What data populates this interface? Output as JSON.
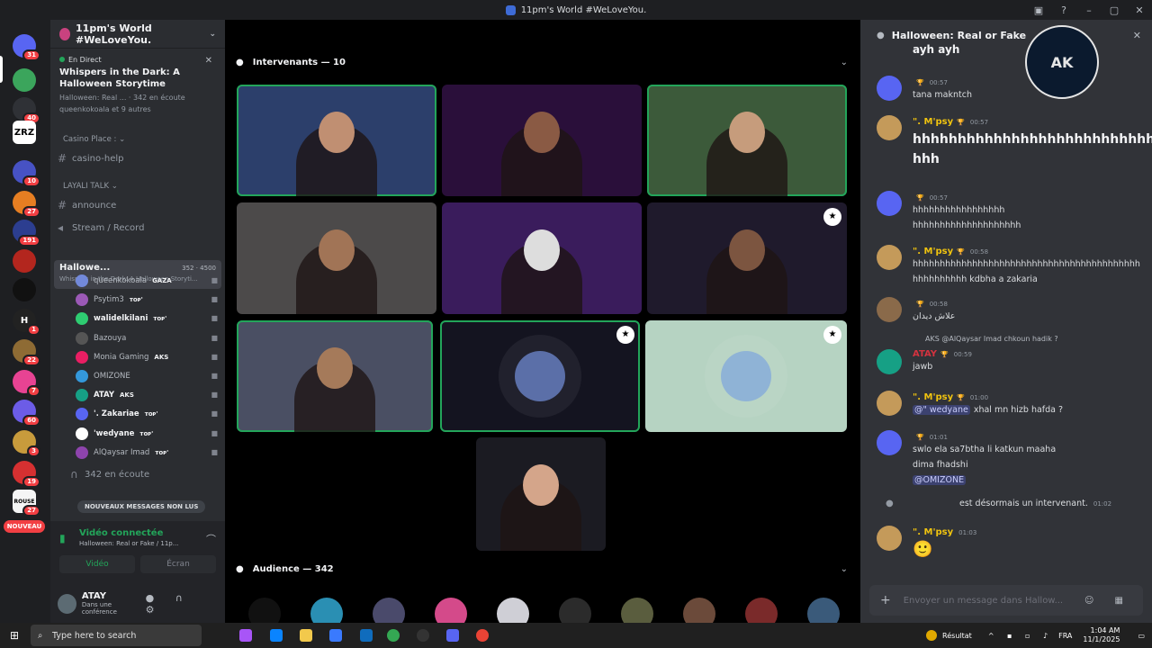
{
  "window": {
    "title": "11pm's World #WeLoveYou."
  },
  "servers": [
    {
      "label": "",
      "badge": "31",
      "color": "#5865f2"
    },
    {
      "label": "",
      "badge": "",
      "color": "#3ba55c"
    },
    {
      "label": "",
      "badge": "40",
      "color": "#2f3136"
    },
    {
      "label": "ZRZ",
      "badge": "",
      "color": "#ffffff"
    },
    {
      "label": "",
      "badge": "10",
      "color": "#4752c4"
    },
    {
      "label": "",
      "badge": "27",
      "color": "#e67e22"
    },
    {
      "label": "",
      "badge": "191",
      "color": "#2c3e90"
    },
    {
      "label": "",
      "badge": "",
      "color": "#b3261e"
    },
    {
      "label": "",
      "badge": "",
      "color": "#111111"
    },
    {
      "label": "H",
      "badge": "1",
      "color": "#222222"
    },
    {
      "label": "",
      "badge": "22",
      "color": "#8e6b34"
    },
    {
      "label": "",
      "badge": "7",
      "color": "#e84393"
    },
    {
      "label": "",
      "badge": "60",
      "color": "#6c5ce7"
    },
    {
      "label": "",
      "badge": "3",
      "color": "#c89b3c"
    },
    {
      "label": "",
      "badge": "19",
      "color": "#d63031"
    },
    {
      "label": "ROUSE",
      "badge": "27",
      "color": "#f5f5f5"
    }
  ],
  "nouveau": "NOUVEAU",
  "sidebar": {
    "server_name": "11pm's World #WeLoveYou.",
    "live": {
      "tag": "En Direct",
      "title": "Whispers in the Dark: A Halloween Storytime",
      "meta": "Halloween: Real ... · 342 en écoute",
      "meta2": "queenkokoala et 9 autres"
    },
    "cat_casino": "Casino Place :",
    "ch_casino_help": "casino-help",
    "cat_layali": "LAYALI TALK",
    "ch_announce": "announce",
    "ch_stream": "Stream / Record",
    "vc_name": "Hallowe...",
    "vc_count": "352",
    "vc_cap": "4500",
    "vc_topic": "Whispers in the Dark: A Halloween Storyti...",
    "members": [
      {
        "name": "queenkokoala",
        "badge": "GAZA",
        "color": "#7289da",
        "bold": false
      },
      {
        "name": "Psytim3",
        "badge": "ᴛᴏᴘ'",
        "color": "#9b59b6",
        "bold": false
      },
      {
        "name": "walidelkilani",
        "badge": "ᴛᴏᴘ'",
        "color": "#2ecc71",
        "bold": true
      },
      {
        "name": "Bazouya",
        "badge": "",
        "color": "#555555",
        "bold": false
      },
      {
        "name": "Monia Gaming",
        "badge": "AKS",
        "color": "#e91e63",
        "bold": false
      },
      {
        "name": "OMIZONE",
        "badge": "",
        "color": "#3498db",
        "bold": false
      },
      {
        "name": "ATAY",
        "badge": "AKS",
        "color": "#16a085",
        "bold": true
      },
      {
        "name": "'. Zakariae",
        "badge": "ᴛᴏᴘ'",
        "color": "#5865f2",
        "bold": true
      },
      {
        "name": "'wedyane",
        "badge": "ᴛᴏᴘ'",
        "color": "#ffffff",
        "bold": true
      },
      {
        "name": "AlQaysar Imad",
        "badge": "ᴛᴏᴘ'",
        "color": "#8e44ad",
        "bold": false
      }
    ],
    "listening": "342 en écoute",
    "unread": "NOUVEAUX MESSAGES NON LUS",
    "conn_title": "Vidéo connectée",
    "conn_sub": "Halloween: Real or Fake / 11p...",
    "btn_video": "Vidéo",
    "btn_screen": "Écran",
    "user_name": "ATAY",
    "user_status": "Dans une conférence"
  },
  "stage": {
    "speakers_label": "Intervenants — 10",
    "audience_label": "Audience — 342",
    "tiles": [
      {
        "bg": "#2c3f6b",
        "skin": "#c08f72",
        "speaking": true,
        "mod": false,
        "kind": "video"
      },
      {
        "bg": "#2a0f3a",
        "skin": "#8a5a44",
        "speaking": false,
        "mod": false,
        "kind": "video"
      },
      {
        "bg": "#3c5a3a",
        "skin": "#c69c7c",
        "speaking": true,
        "mod": false,
        "kind": "video"
      },
      {
        "bg": "#4c4a4a",
        "skin": "#a17456",
        "speaking": false,
        "mod": false,
        "kind": "video"
      },
      {
        "bg": "#3a1c5c",
        "skin": "#ddd",
        "speaking": false,
        "mod": false,
        "kind": "video"
      },
      {
        "bg": "#1f1a2c",
        "skin": "#7c5540",
        "speaking": false,
        "mod": true,
        "kind": "video"
      },
      {
        "bg": "#4a4f63",
        "skin": "#a57a5a",
        "speaking": true,
        "mod": false,
        "kind": "video"
      },
      {
        "bg": "#141420",
        "skin": "",
        "speaking": true,
        "mod": true,
        "kind": "avatar"
      },
      {
        "bg": "#b6d3c2",
        "skin": "",
        "speaking": false,
        "mod": true,
        "kind": "avatar"
      },
      {
        "bg": "#1b1b22",
        "skin": "#d4a58a",
        "speaking": false,
        "mod": false,
        "kind": "video"
      }
    ],
    "audience": [
      "#111",
      "#2a8fb3",
      "#4a4a6b",
      "#d44a8a",
      "#cfcfd6",
      "#2b2b2b",
      "#5a5d3e",
      "#6b4a3a",
      "#7a2a2a",
      "#3a5a7a"
    ]
  },
  "chat": {
    "header": "Halloween: Real or Fake",
    "logo_text": "AK",
    "top_partial": "ayh ayh",
    "messages": [
      {
        "name": "",
        "time": "00:57",
        "text": "tana makntch",
        "av": "#5865f2",
        "nc": "#d4333f"
      },
      {
        "name": "\". M'psy",
        "time": "00:57",
        "text": "hhhhhhhhhhhhhhhhhhhhhhhhhhhhhh hhh",
        "av": "#c49a5a",
        "nc": "#f1c40f",
        "big": true
      },
      {
        "name": "",
        "time": "00:57",
        "text": "hhhhhhhhhhhhhhhhh",
        "text2": "hhhhhhhhhhhhhhhhhhhh",
        "av": "#5865f2",
        "nc": "#d4333f"
      },
      {
        "name": "\". M'psy",
        "time": "00:58",
        "text": "hhhhhhhhhhhhhhhhhhhhhhhhhhhhhhhhhhhhhhhhhh",
        "text2": "hhhhhhhhhh kdbha a zakaria",
        "edited": "(modifié)",
        "av": "#c49a5a",
        "nc": "#f1c40f"
      },
      {
        "name": "",
        "time": "00:58",
        "text": "علاش ديدان",
        "av": "#8a6a4a",
        "nc": "#c05050"
      },
      {
        "name": "ATAY",
        "time": "00:59",
        "text": "jawb",
        "reply": "AKS @AlQaysar Imad chkoun hadik ?",
        "av": "#16a085",
        "nc": "#d4333f"
      },
      {
        "name": "\". M'psy",
        "time": "01:00",
        "text": "xhal mn hizb hafda ?",
        "mention": "@\" wedyane",
        "av": "#c49a5a",
        "nc": "#f1c40f"
      },
      {
        "name": "",
        "time": "01:01",
        "text": "swlo ela sa7btha li katkun maaha",
        "text2": "dima fhadshi",
        "mention": "@OMIZONE",
        "av": "#5865f2",
        "nc": "#d4333f"
      }
    ],
    "system": "est désormais un intervenant.",
    "system_time": "01:02",
    "last_name": "\". M'psy",
    "last_time": "01:03",
    "last_text": "🙂",
    "composer": "Envoyer un message dans",
    "composer2": "Hallow..."
  },
  "taskbar": {
    "search": "Type here to search",
    "weather": "Résultat",
    "lang": "FRA",
    "time": "1:04 AM",
    "date": "11/1/2025"
  }
}
